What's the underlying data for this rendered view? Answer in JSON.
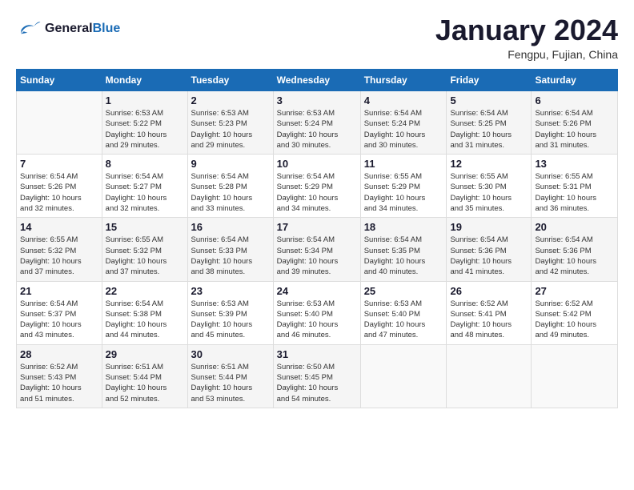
{
  "header": {
    "logo_line1": "General",
    "logo_line2": "Blue",
    "month_title": "January 2024",
    "subtitle": "Fengpu, Fujian, China"
  },
  "days_of_week": [
    "Sunday",
    "Monday",
    "Tuesday",
    "Wednesday",
    "Thursday",
    "Friday",
    "Saturday"
  ],
  "weeks": [
    [
      {
        "day": "",
        "info": ""
      },
      {
        "day": "1",
        "info": "Sunrise: 6:53 AM\nSunset: 5:22 PM\nDaylight: 10 hours\nand 29 minutes."
      },
      {
        "day": "2",
        "info": "Sunrise: 6:53 AM\nSunset: 5:23 PM\nDaylight: 10 hours\nand 29 minutes."
      },
      {
        "day": "3",
        "info": "Sunrise: 6:53 AM\nSunset: 5:24 PM\nDaylight: 10 hours\nand 30 minutes."
      },
      {
        "day": "4",
        "info": "Sunrise: 6:54 AM\nSunset: 5:24 PM\nDaylight: 10 hours\nand 30 minutes."
      },
      {
        "day": "5",
        "info": "Sunrise: 6:54 AM\nSunset: 5:25 PM\nDaylight: 10 hours\nand 31 minutes."
      },
      {
        "day": "6",
        "info": "Sunrise: 6:54 AM\nSunset: 5:26 PM\nDaylight: 10 hours\nand 31 minutes."
      }
    ],
    [
      {
        "day": "7",
        "info": "Sunrise: 6:54 AM\nSunset: 5:26 PM\nDaylight: 10 hours\nand 32 minutes."
      },
      {
        "day": "8",
        "info": "Sunrise: 6:54 AM\nSunset: 5:27 PM\nDaylight: 10 hours\nand 32 minutes."
      },
      {
        "day": "9",
        "info": "Sunrise: 6:54 AM\nSunset: 5:28 PM\nDaylight: 10 hours\nand 33 minutes."
      },
      {
        "day": "10",
        "info": "Sunrise: 6:54 AM\nSunset: 5:29 PM\nDaylight: 10 hours\nand 34 minutes."
      },
      {
        "day": "11",
        "info": "Sunrise: 6:55 AM\nSunset: 5:29 PM\nDaylight: 10 hours\nand 34 minutes."
      },
      {
        "day": "12",
        "info": "Sunrise: 6:55 AM\nSunset: 5:30 PM\nDaylight: 10 hours\nand 35 minutes."
      },
      {
        "day": "13",
        "info": "Sunrise: 6:55 AM\nSunset: 5:31 PM\nDaylight: 10 hours\nand 36 minutes."
      }
    ],
    [
      {
        "day": "14",
        "info": "Sunrise: 6:55 AM\nSunset: 5:32 PM\nDaylight: 10 hours\nand 37 minutes."
      },
      {
        "day": "15",
        "info": "Sunrise: 6:55 AM\nSunset: 5:32 PM\nDaylight: 10 hours\nand 37 minutes."
      },
      {
        "day": "16",
        "info": "Sunrise: 6:54 AM\nSunset: 5:33 PM\nDaylight: 10 hours\nand 38 minutes."
      },
      {
        "day": "17",
        "info": "Sunrise: 6:54 AM\nSunset: 5:34 PM\nDaylight: 10 hours\nand 39 minutes."
      },
      {
        "day": "18",
        "info": "Sunrise: 6:54 AM\nSunset: 5:35 PM\nDaylight: 10 hours\nand 40 minutes."
      },
      {
        "day": "19",
        "info": "Sunrise: 6:54 AM\nSunset: 5:36 PM\nDaylight: 10 hours\nand 41 minutes."
      },
      {
        "day": "20",
        "info": "Sunrise: 6:54 AM\nSunset: 5:36 PM\nDaylight: 10 hours\nand 42 minutes."
      }
    ],
    [
      {
        "day": "21",
        "info": "Sunrise: 6:54 AM\nSunset: 5:37 PM\nDaylight: 10 hours\nand 43 minutes."
      },
      {
        "day": "22",
        "info": "Sunrise: 6:54 AM\nSunset: 5:38 PM\nDaylight: 10 hours\nand 44 minutes."
      },
      {
        "day": "23",
        "info": "Sunrise: 6:53 AM\nSunset: 5:39 PM\nDaylight: 10 hours\nand 45 minutes."
      },
      {
        "day": "24",
        "info": "Sunrise: 6:53 AM\nSunset: 5:40 PM\nDaylight: 10 hours\nand 46 minutes."
      },
      {
        "day": "25",
        "info": "Sunrise: 6:53 AM\nSunset: 5:40 PM\nDaylight: 10 hours\nand 47 minutes."
      },
      {
        "day": "26",
        "info": "Sunrise: 6:52 AM\nSunset: 5:41 PM\nDaylight: 10 hours\nand 48 minutes."
      },
      {
        "day": "27",
        "info": "Sunrise: 6:52 AM\nSunset: 5:42 PM\nDaylight: 10 hours\nand 49 minutes."
      }
    ],
    [
      {
        "day": "28",
        "info": "Sunrise: 6:52 AM\nSunset: 5:43 PM\nDaylight: 10 hours\nand 51 minutes."
      },
      {
        "day": "29",
        "info": "Sunrise: 6:51 AM\nSunset: 5:44 PM\nDaylight: 10 hours\nand 52 minutes."
      },
      {
        "day": "30",
        "info": "Sunrise: 6:51 AM\nSunset: 5:44 PM\nDaylight: 10 hours\nand 53 minutes."
      },
      {
        "day": "31",
        "info": "Sunrise: 6:50 AM\nSunset: 5:45 PM\nDaylight: 10 hours\nand 54 minutes."
      },
      {
        "day": "",
        "info": ""
      },
      {
        "day": "",
        "info": ""
      },
      {
        "day": "",
        "info": ""
      }
    ]
  ]
}
